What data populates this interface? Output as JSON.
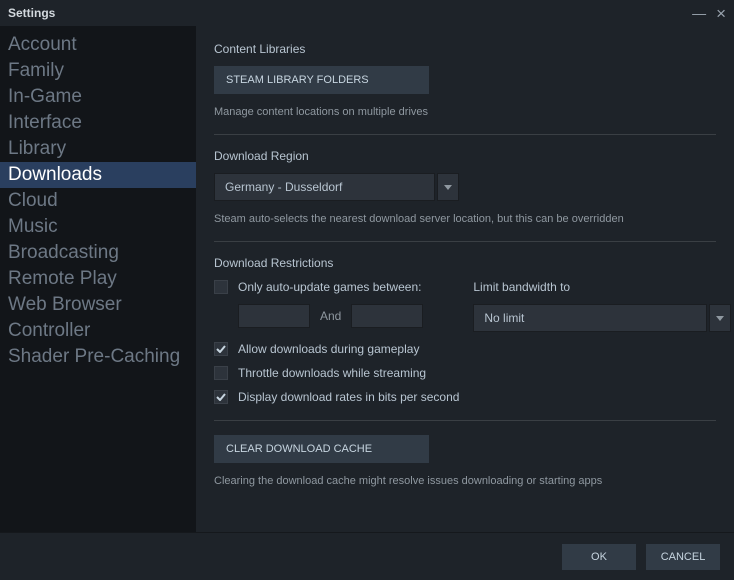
{
  "window": {
    "title": "Settings"
  },
  "sidebar": {
    "items": [
      {
        "label": "Account"
      },
      {
        "label": "Family"
      },
      {
        "label": "In-Game"
      },
      {
        "label": "Interface"
      },
      {
        "label": "Library"
      },
      {
        "label": "Downloads"
      },
      {
        "label": "Cloud"
      },
      {
        "label": "Music"
      },
      {
        "label": "Broadcasting"
      },
      {
        "label": "Remote Play"
      },
      {
        "label": "Web Browser"
      },
      {
        "label": "Controller"
      },
      {
        "label": "Shader Pre-Caching"
      }
    ],
    "selected_index": 5
  },
  "content_libraries": {
    "heading": "Content Libraries",
    "button": "STEAM LIBRARY FOLDERS",
    "desc": "Manage content locations on multiple drives"
  },
  "region": {
    "heading": "Download Region",
    "selected": "Germany - Dusseldorf",
    "desc": "Steam auto-selects the nearest download server location, but this can be overridden"
  },
  "restrictions": {
    "heading": "Download Restrictions",
    "auto_update_label": "Only auto-update games between:",
    "and_label": "And",
    "limit_heading": "Limit bandwidth to",
    "limit_selected": "No limit",
    "allow_gameplay_label": "Allow downloads during gameplay",
    "throttle_label": "Throttle downloads while streaming",
    "display_bits_label": "Display download rates in bits per second"
  },
  "cache": {
    "button": "CLEAR DOWNLOAD CACHE",
    "desc": "Clearing the download cache might resolve issues downloading or starting apps"
  },
  "footer": {
    "ok": "OK",
    "cancel": "CANCEL"
  }
}
